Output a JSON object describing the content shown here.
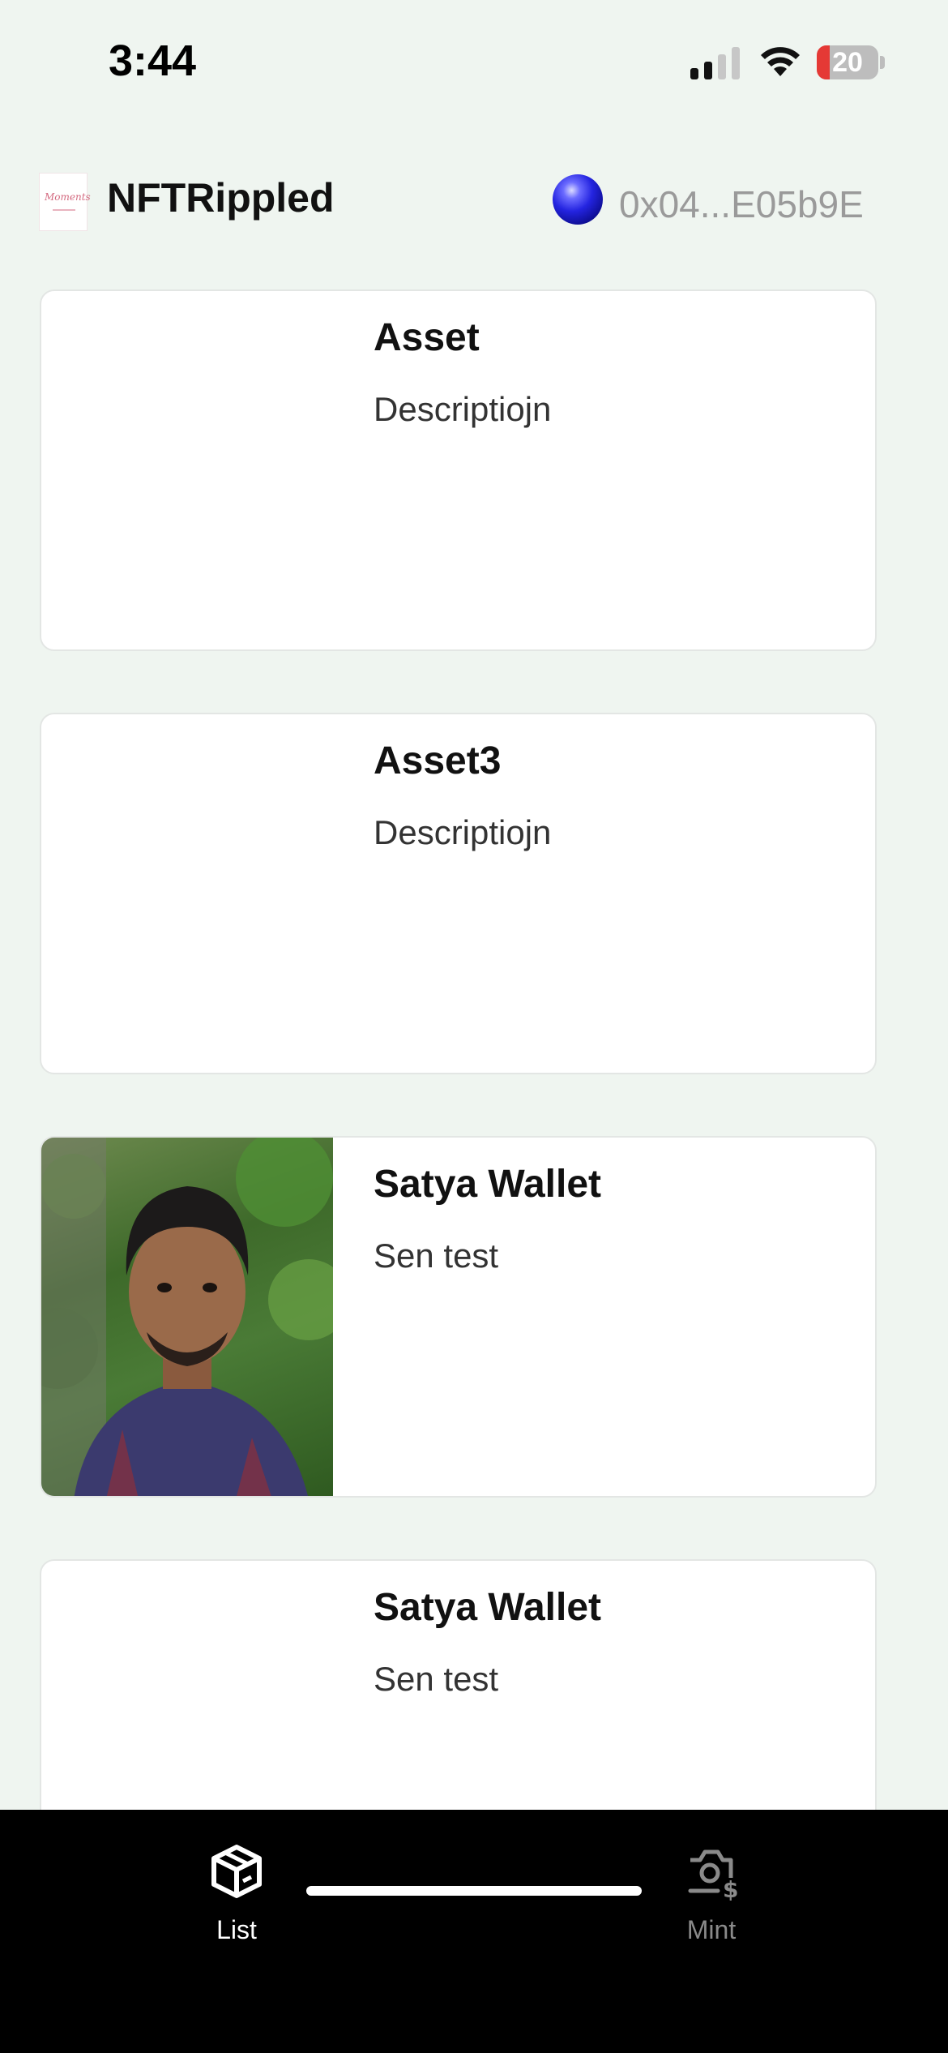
{
  "status_bar": {
    "time": "3:44",
    "battery_level": "20"
  },
  "header": {
    "app_title": "NFTRippled",
    "wallet_address": "0x04...E05b9E"
  },
  "cards": [
    {
      "title": "Asset",
      "description": "Descriptiojn",
      "has_image": false
    },
    {
      "title": "Asset3",
      "description": "Descriptiojn",
      "has_image": false
    },
    {
      "title": "Satya Wallet",
      "description": "Sen test",
      "has_image": true
    },
    {
      "title": "Satya Wallet",
      "description": "Sen test",
      "has_image": false
    }
  ],
  "tab_bar": {
    "tabs": [
      {
        "label": "List",
        "icon": "cube-icon",
        "active": true
      },
      {
        "label": "Mint",
        "icon": "camera-dollar-icon",
        "active": false
      }
    ]
  },
  "colors": {
    "background": "#eff5f0",
    "card": "#ffffff",
    "tab_bar": "#000000",
    "active_tab": "#ffffff",
    "inactive_tab": "#8a8a8a",
    "wallet_text": "#9a9a9a"
  }
}
